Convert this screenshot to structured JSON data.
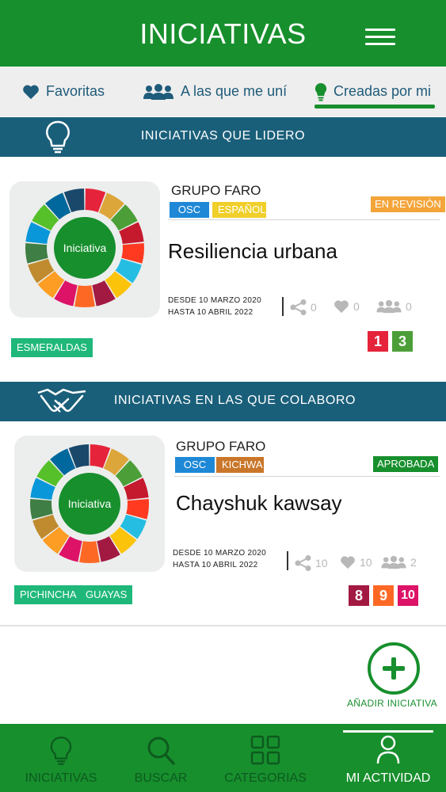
{
  "header": {
    "title": "INICIATIVAS",
    "menu_icon": "hamburger-menu-icon"
  },
  "tabs": [
    {
      "label": "Favoritas",
      "icon": "heart-icon",
      "active": false
    },
    {
      "label": "A las que me uní",
      "icon": "group-icon",
      "active": false
    },
    {
      "label": "Creadas por mi",
      "icon": "lightbulb-icon",
      "active": true
    }
  ],
  "sections": {
    "lead": {
      "title": "INICIATIVAS QUE LIDERO",
      "icon": "lightbulb-icon"
    },
    "collab": {
      "title": "INICIATIVAS EN LAS QUE COLABORO",
      "icon": "handshake-icon"
    }
  },
  "cards": [
    {
      "wheel_label": "Iniciativa",
      "organization": "GRUPO FARO",
      "tags": [
        "OSC",
        "ESPAÑOL"
      ],
      "status": "EN REVISIÓN",
      "title": "Resiliencia urbana",
      "date_from": "DESDE 10 MARZO 2020",
      "date_to": "HASTA 10 ABRIL 2022",
      "shares": "0",
      "likes": "0",
      "members": "0",
      "regions": [
        "ESMERALDAS"
      ],
      "sdgs": [
        {
          "number": "1",
          "color": "#e5243b"
        },
        {
          "number": "3",
          "color": "#4c9f38"
        }
      ]
    },
    {
      "wheel_label": "Iniciativa",
      "organization": "GRUPO FARO",
      "tags": [
        "OSC",
        "KICHWA"
      ],
      "status": "APROBADA",
      "title": "Chayshuk kawsay",
      "date_from": "DESDE 10 MARZO 2020",
      "date_to": "HASTA 10 ABRIL 2022",
      "shares": "10",
      "likes": "10",
      "members": "2",
      "regions": [
        "PICHINCHA",
        "GUAYAS"
      ],
      "sdgs": [
        {
          "number": "8",
          "color": "#a21942"
        },
        {
          "number": "9",
          "color": "#fd6925"
        },
        {
          "number": "10",
          "color": "#dd1367"
        }
      ]
    }
  ],
  "add_button": {
    "label": "AÑADIR INICIATIVA"
  },
  "bottom_nav": [
    {
      "label": "INICIATIVAS",
      "icon": "lightbulb-icon",
      "active": false
    },
    {
      "label": "BUSCAR",
      "icon": "search-icon",
      "active": false
    },
    {
      "label": "CATEGORIAS",
      "icon": "grid-icon",
      "active": false
    },
    {
      "label": "MI ACTIVIDAD",
      "icon": "user-icon",
      "active": true
    }
  ],
  "colors": {
    "primary_green": "#178f2d",
    "section_blue": "#1a5f7a"
  }
}
